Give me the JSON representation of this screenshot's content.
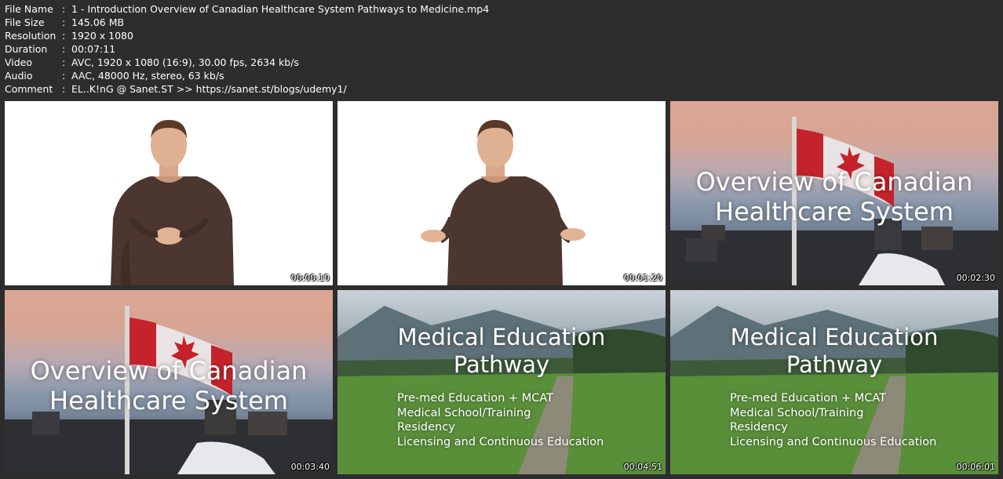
{
  "metadata": [
    {
      "key": "File Name",
      "value": "1 - Introduction Overview of Canadian Healthcare System Pathways to Medicine.mp4"
    },
    {
      "key": "File Size",
      "value": "145.06 MB"
    },
    {
      "key": "Resolution",
      "value": "1920 x 1080"
    },
    {
      "key": "Duration",
      "value": "00:07:11"
    },
    {
      "key": "Video",
      "value": "AVC, 1920 x 1080 (16:9), 30.00 fps, 2634 kb/s"
    },
    {
      "key": "Audio",
      "value": "AAC, 48000 Hz, stereo, 63 kb/s"
    },
    {
      "key": "Comment",
      "value": "EL..K!nG @ Sanet.ST >> https://sanet.st/blogs/udemy1/"
    }
  ],
  "separator": ":",
  "thumbnails": [
    {
      "timestamp": "00:00:10"
    },
    {
      "timestamp": "00:01:20"
    },
    {
      "timestamp": "00:02:30",
      "title": "Overview of Canadian\nHealthcare System"
    },
    {
      "timestamp": "00:03:40",
      "title": "Overview of Canadian\nHealthcare System"
    },
    {
      "timestamp": "00:04:51",
      "title": "Medical Education\nPathway",
      "bullets": [
        "Pre-med Education + MCAT",
        "Medical School/Training",
        "Residency",
        "Licensing and Continuous Education"
      ]
    },
    {
      "timestamp": "00:06:01",
      "title": "Medical Education\nPathway",
      "bullets": [
        "Pre-med Education + MCAT",
        "Medical School/Training",
        "Residency",
        "Licensing and Continuous Education"
      ]
    }
  ]
}
